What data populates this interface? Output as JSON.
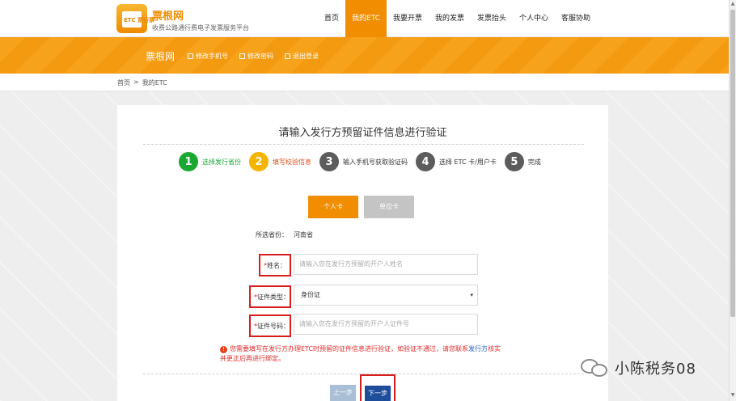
{
  "header": {
    "logo_text": "ETC 票行票",
    "brand_name": "票根网",
    "brand_sub": "收费公路通行费电子发票服务平台",
    "nav": [
      {
        "label": "首页",
        "active": false
      },
      {
        "label": "我的ETC",
        "active": true
      },
      {
        "label": "我要开票",
        "active": false
      },
      {
        "label": "我的发票",
        "active": false
      },
      {
        "label": "发票抬头",
        "active": false
      },
      {
        "label": "个人中心",
        "active": false
      },
      {
        "label": "客服协助",
        "active": false
      }
    ]
  },
  "banner": {
    "title": "票根网",
    "links": [
      "修改手机号",
      "修改密码",
      "退出登录"
    ]
  },
  "breadcrumb": [
    "首页",
    ">",
    "我的ETC"
  ],
  "form": {
    "title": "请输入发行方预留证件信息进行验证",
    "steps": [
      {
        "num": "1",
        "label": "选择发行省份"
      },
      {
        "num": "2",
        "label": "填写校验信息"
      },
      {
        "num": "3",
        "label": "输入手机号获取验证码"
      },
      {
        "num": "4",
        "label": "选择 ETC 卡/用户卡"
      },
      {
        "num": "5",
        "label": "完成"
      }
    ],
    "tabs": {
      "personal": "个人卡",
      "unit": "单位卡"
    },
    "province_label": "所选省份：",
    "province_value": "河南省",
    "star": "*",
    "name_label": "姓名：",
    "name_placeholder": "请输入您在发行方预留的开户人姓名",
    "type_label": "证件类型：",
    "type_value": "身份证",
    "number_label": "证件号码：",
    "number_placeholder": "请输入您在发行方预留的开户人证件号",
    "notice_icon": "!",
    "notice_before": "您需要填写在发行方办理ETC时预留的证件信息进行验证，如验证不通过，请您联系",
    "notice_link": "发行方",
    "notice_after": "核实并更正后再进行绑定。",
    "prev_label": "上一步",
    "next_label": "下一步"
  },
  "watermark": {
    "text": "小陈税务08"
  },
  "colors": {
    "accent": "#f18d00",
    "step_done": "#1aa833",
    "step_current": "#f5b400",
    "next_button": "#1d4d9b",
    "highlight_box": "#d71e1e"
  }
}
